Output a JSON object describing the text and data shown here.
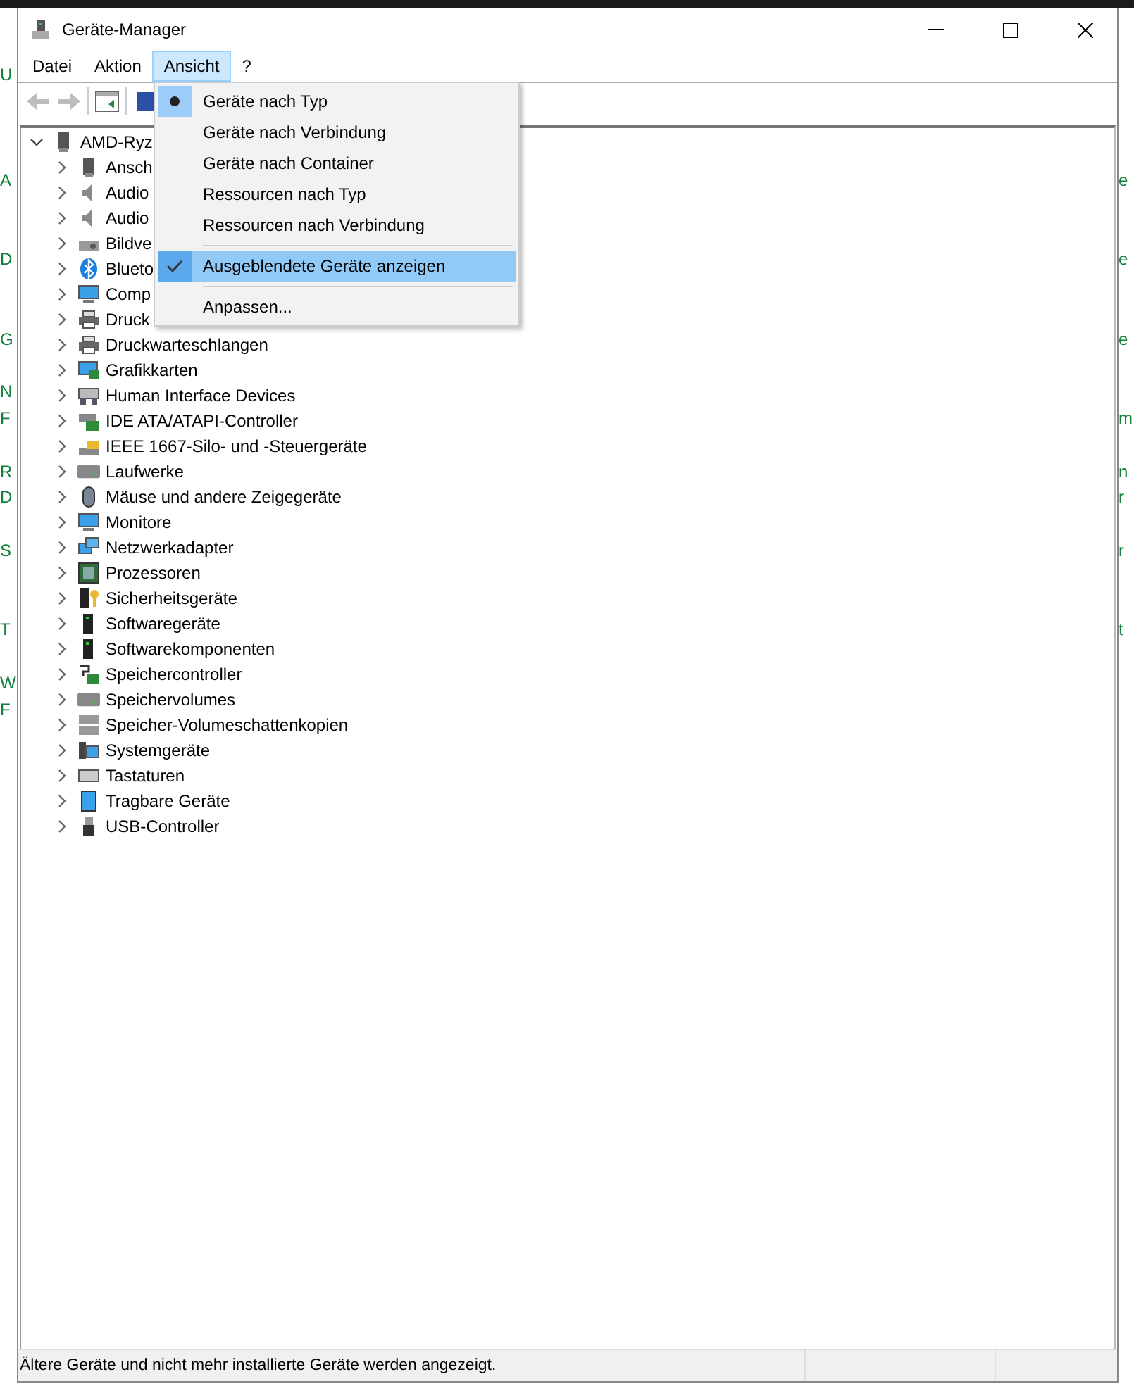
{
  "background": {
    "left_fragments": [
      "U",
      "A",
      "D",
      "G",
      "N",
      "F",
      "R",
      "D",
      "S",
      "T",
      "W",
      "F"
    ],
    "right_fragments": [
      "e",
      "e",
      "e",
      "m",
      "n",
      "r",
      "r",
      "t"
    ]
  },
  "window": {
    "title": "Geräte-Manager"
  },
  "menu_bar": [
    {
      "label": "Datei",
      "selected": false
    },
    {
      "label": "Aktion",
      "selected": false
    },
    {
      "label": "Ansicht",
      "selected": true
    },
    {
      "label": "?",
      "selected": false
    }
  ],
  "toolbar": [
    {
      "kind": "back",
      "disabled": true
    },
    {
      "kind": "forward",
      "disabled": true
    },
    {
      "kind": "separator"
    },
    {
      "kind": "properties",
      "disabled": false
    },
    {
      "kind": "separator"
    },
    {
      "kind": "driver"
    }
  ],
  "dropdown": [
    {
      "kind": "radio",
      "label": "Geräte nach Typ",
      "selected": true
    },
    {
      "kind": "radio",
      "label": "Geräte nach Verbindung",
      "selected": false
    },
    {
      "kind": "radio",
      "label": "Geräte nach Container",
      "selected": false
    },
    {
      "kind": "radio",
      "label": "Ressourcen nach Typ",
      "selected": false
    },
    {
      "kind": "radio",
      "label": "Ressourcen nach Verbindung",
      "selected": false
    },
    {
      "kind": "separator"
    },
    {
      "kind": "check",
      "label": "Ausgeblendete Geräte anzeigen",
      "checked": true,
      "highlighted": true
    },
    {
      "kind": "separator"
    },
    {
      "kind": "plain",
      "label": "Anpassen..."
    }
  ],
  "tree": {
    "label": "AMD-Ryz",
    "expanded": true,
    "children": [
      {
        "label": "Ansch",
        "expanded": false
      },
      {
        "label": "Audio",
        "expanded": false
      },
      {
        "label": "Audio",
        "expanded": false
      },
      {
        "label": "Bildve",
        "expanded": false
      },
      {
        "label": "Blueto",
        "expanded": false
      },
      {
        "label": "Comp",
        "expanded": false
      },
      {
        "label": "Druck",
        "expanded": false
      },
      {
        "label": "Druckwarteschlangen",
        "expanded": false
      },
      {
        "label": "Grafikkarten",
        "expanded": false
      },
      {
        "label": "Human Interface Devices",
        "expanded": false
      },
      {
        "label": "IDE ATA/ATAPI-Controller",
        "expanded": false
      },
      {
        "label": "IEEE 1667-Silo- und -Steuergeräte",
        "expanded": false
      },
      {
        "label": "Laufwerke",
        "expanded": false
      },
      {
        "label": "Mäuse und andere Zeigegeräte",
        "expanded": false
      },
      {
        "label": "Monitore",
        "expanded": false
      },
      {
        "label": "Netzwerkadapter",
        "expanded": false
      },
      {
        "label": "Prozessoren",
        "expanded": false
      },
      {
        "label": "Sicherheitsgeräte",
        "expanded": false
      },
      {
        "label": "Softwaregeräte",
        "expanded": false
      },
      {
        "label": "Softwarekomponenten",
        "expanded": false
      },
      {
        "label": "Speichercontroller",
        "expanded": false
      },
      {
        "label": "Speichervolumes",
        "expanded": false
      },
      {
        "label": "Speicher-Volumeschattenkopien",
        "expanded": false
      },
      {
        "label": "Systemgeräte",
        "expanded": false
      },
      {
        "label": "Tastaturen",
        "expanded": false
      },
      {
        "label": "Tragbare Geräte",
        "expanded": false
      },
      {
        "label": "USB-Controller",
        "expanded": false
      }
    ]
  },
  "status_bar": {
    "text": "Ältere Geräte und nicht mehr installierte Geräte werden angezeigt."
  }
}
